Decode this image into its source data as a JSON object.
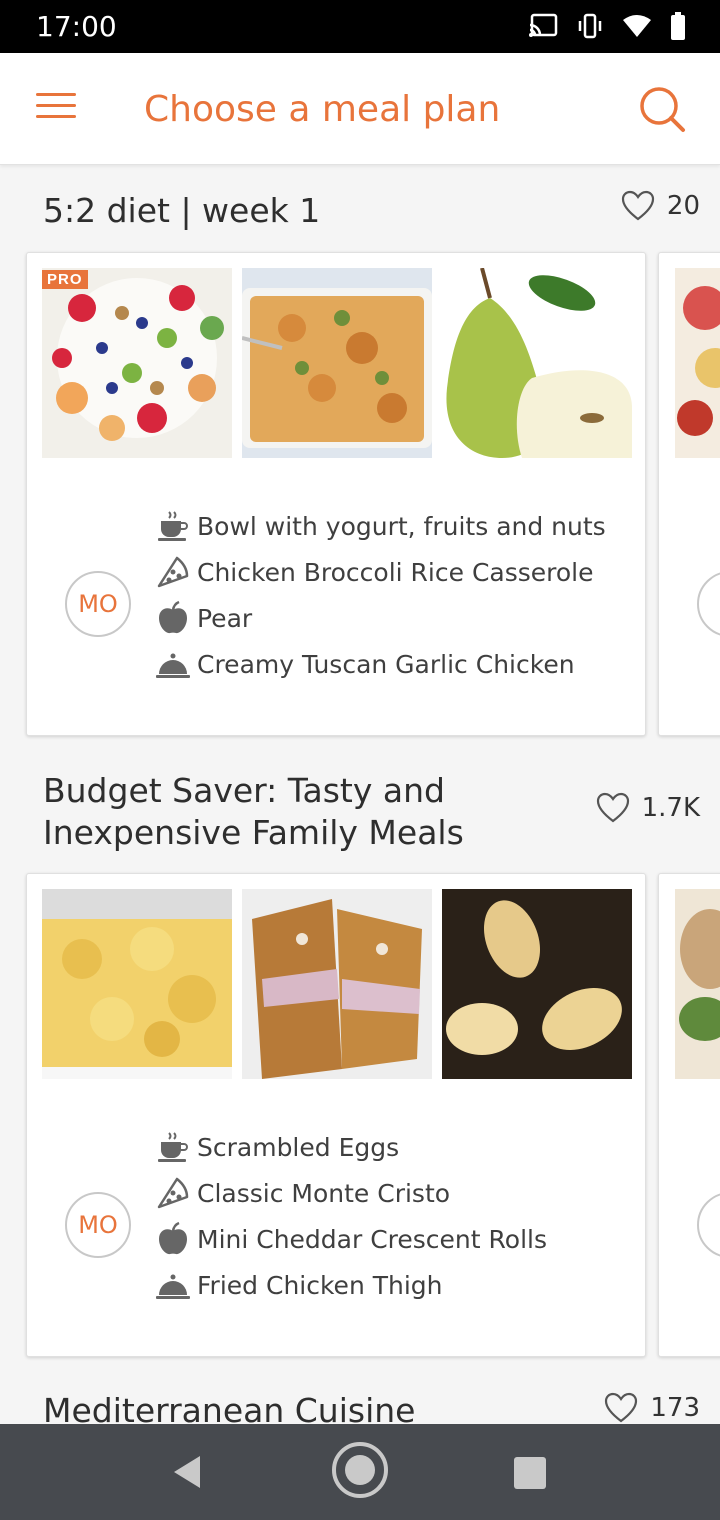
{
  "status_bar": {
    "time": "17:00"
  },
  "app_bar": {
    "title": "Choose a meal plan"
  },
  "plans": [
    {
      "title": "5:2 diet | week 1",
      "likes": "20",
      "badge": "PRO",
      "day": "MO",
      "meals": [
        {
          "icon": "coffee-cup-icon",
          "label": "Bowl with yogurt, fruits and nuts"
        },
        {
          "icon": "pizza-slice-icon",
          "label": "Chicken Broccoli Rice Casserole"
        },
        {
          "icon": "apple-icon",
          "label": "Pear"
        },
        {
          "icon": "cloche-icon",
          "label": "Creamy Tuscan Garlic Chicken"
        }
      ]
    },
    {
      "title_line1": "Budget Saver: Tasty and",
      "title_line2": "Inexpensive Family Meals",
      "likes": "1.7K",
      "day": "MO",
      "meals": [
        {
          "icon": "coffee-cup-icon",
          "label": "Scrambled Eggs"
        },
        {
          "icon": "pizza-slice-icon",
          "label": "Classic Monte Cristo"
        },
        {
          "icon": "apple-icon",
          "label": "Mini Cheddar Crescent Rolls"
        },
        {
          "icon": "cloche-icon",
          "label": "Fried Chicken Thigh"
        }
      ]
    },
    {
      "title": "Mediterranean Cuisine",
      "likes": "173"
    }
  ],
  "colors": {
    "accent": "#e8743b",
    "nav_bar": "#474a4f"
  }
}
